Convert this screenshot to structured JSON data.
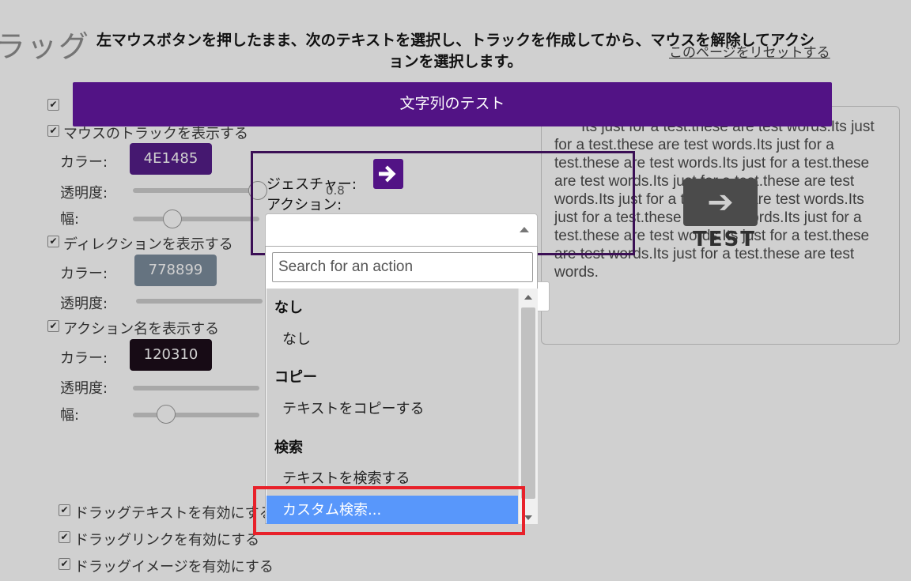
{
  "background": {
    "title": "ラッグ",
    "reset_link": "このページをリセットする",
    "opt_show_track": "マウスのトラックを表示する",
    "color_label": "カラー:",
    "opacity_label": "透明度:",
    "width_label": "幅:",
    "track_color": "4E1485",
    "track_opacity": "0.8",
    "opt_show_direction": "ディレクションを表示する",
    "direction_color": "778899",
    "opt_show_action_name": "アクション名を表示する",
    "action_name_color": "120310",
    "opt_drag_text": "ドラッグテキストを有効にする",
    "opt_drag_link": "ドラッグリンクを有効にする",
    "opt_drag_image": "ドラッグイメージを有効にする",
    "preview_text": "Its just for a test.these are test words.Its just for a test.these are test words.Its just for a test.these are test words.Its just for a test.these are test words.Its just for a test.these are test words.Its just for a test.these are test words.Its just for a test.these are test words.Its just for a test.these are test words.Its just for a test.these are test words.Its just for a test.these are test words.",
    "preview_label": "TEST"
  },
  "dialog": {
    "instruction": "左マウスボタンを押したまま、次のテキストを選択し、トラックを作成してから、マウスを解除してアクションを選択します。",
    "test_button": "文字列のテスト",
    "gesture_label": "ジェスチャー:",
    "action_label": "アクション:",
    "search_placeholder": "Search for an action",
    "groups": [
      {
        "header": "なし",
        "options": [
          "なし"
        ]
      },
      {
        "header": "コピー",
        "options": [
          "テキストをコピーする"
        ]
      },
      {
        "header": "検索",
        "options": [
          "テキストを検索する",
          "カスタム検索..."
        ]
      }
    ],
    "highlighted_option": "カスタム検索..."
  },
  "colors": {
    "accent": "#521385",
    "highlight": "#5897fb",
    "annotation": "#e8212a",
    "track_swatch": "#4E1485",
    "direction_swatch": "#778899",
    "action_name_swatch": "#120310"
  }
}
